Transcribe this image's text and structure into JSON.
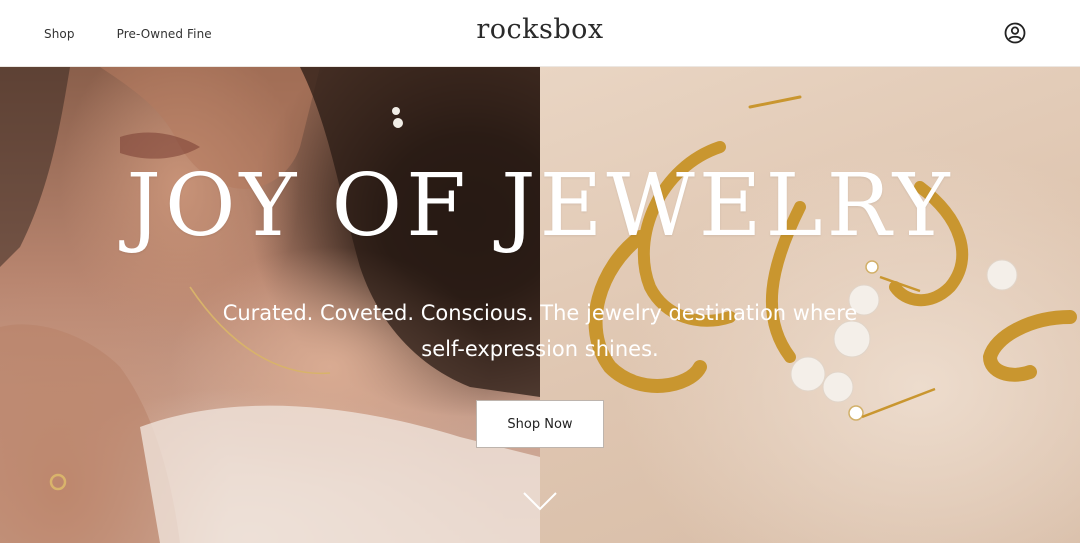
{
  "header": {
    "nav": [
      {
        "label": "Shop"
      },
      {
        "label": "Pre-Owned Fine"
      }
    ],
    "logo": "rocksbox",
    "account_icon": "user-circle-icon"
  },
  "hero": {
    "title": "JOY OF JEWELRY",
    "subtitle": "Curated. Coveted. Conscious. The jewelry destination where self-expression shines.",
    "cta_label": "Shop Now",
    "scroll_icon": "chevron-down-icon",
    "image_left": "model-wearing-jewelry-photo",
    "image_right": "gold-hoops-and-pearl-earrings-photo"
  },
  "colors": {
    "text": "#222222",
    "hero_text": "#ffffff",
    "right_panel_bg": "#e2cbb7"
  }
}
